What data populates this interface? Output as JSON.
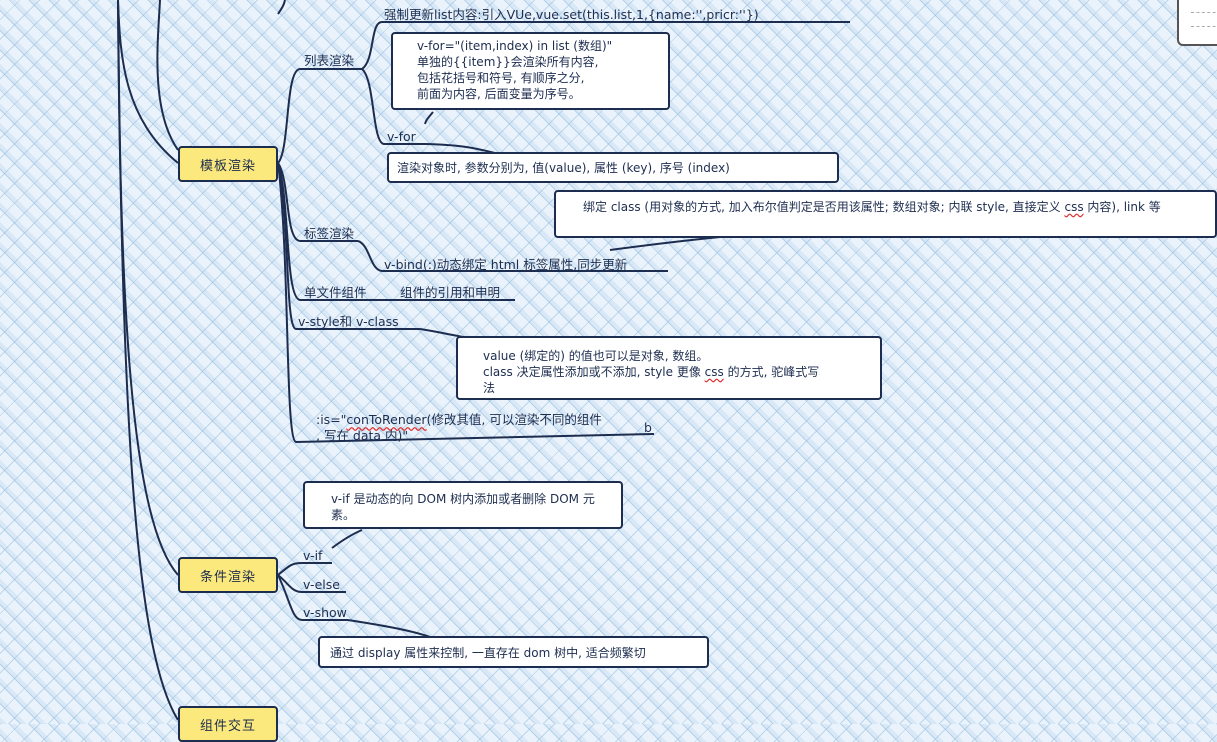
{
  "topics": {
    "template_render": "模板渲染",
    "conditional_render": "条件渲染",
    "component_comm": "组件交互"
  },
  "template": {
    "force_update": "强制更新list内容:引入VUe,vue.set(this.list,1,{name:'',pricr:''})",
    "list_render": "列表渲染",
    "vfor_note": [
      "v-for=\"(item,index) in list (数组)\"",
      "单独的{{item}}会渲染所有内容,",
      "包括花括号和符号, 有顺序之分,",
      "前面为内容, 后面变量为序号。"
    ],
    "vfor": "v-for",
    "object_note": "渲染对象时, 参数分别为, 值(value), 属性 (key), 序号 (index)",
    "tag_render": "标签渲染",
    "bind_note": [
      "绑定 class (用对象的方式, 加入布尔值判定是否用该属性; 数组对象; 内联 style, 直接定义 ",
      "css",
      " 内容), link 等"
    ],
    "vbind": "v-bind(:)动态绑定 html 标签属性,同步更新",
    "single_file": "单文件组件",
    "single_file_desc": "组件的引用和申明",
    "style_class": "v-style和 v-class",
    "style_note": [
      "value (绑定的) 的值也可以是对象, 数组。",
      "class 决定属性添加或不添加, style 更像 ",
      "css",
      " 的方式, 驼峰式写",
      "法"
    ],
    "is_prefix": ":is=\"",
    "is_word": "conToRender",
    "is_rest": "(修改其值, 可以渲染不同的组件",
    "is_line2": ", 写在 data 内)\"",
    "b": "b"
  },
  "conditional": {
    "vif_note": [
      "v-if 是动态的向 DOM 树内添加或者删除 DOM 元",
      "素。"
    ],
    "vif": "v-if",
    "velse": "v-else",
    "vshow": "v-show",
    "vshow_note": "通过 display 属性来控制, 一直存在 dom 树中, 适合频繁切"
  }
}
